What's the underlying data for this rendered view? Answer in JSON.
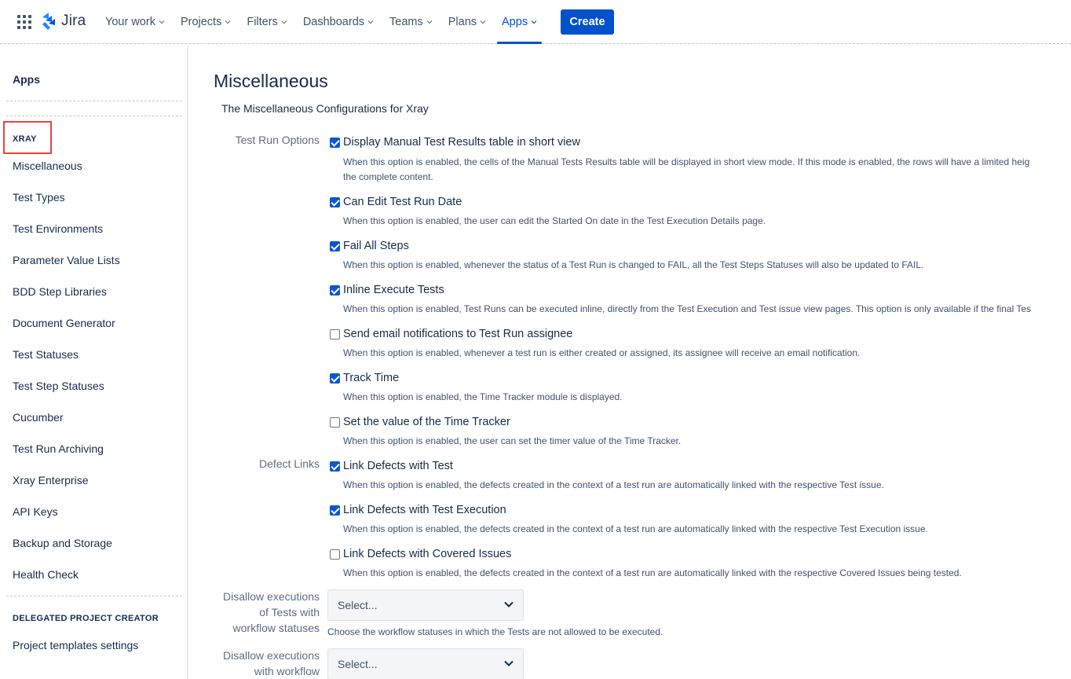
{
  "topnav": {
    "logo_text": "Jira",
    "items": [
      {
        "label": "Your work"
      },
      {
        "label": "Projects"
      },
      {
        "label": "Filters"
      },
      {
        "label": "Dashboards"
      },
      {
        "label": "Teams"
      },
      {
        "label": "Plans"
      },
      {
        "label": "Apps",
        "active": true
      }
    ],
    "create_label": "Create",
    "accent_color": "#0052cc"
  },
  "sidebar": {
    "title": "Apps",
    "section_xray": "XRAY",
    "items": [
      "Miscellaneous",
      "Test Types",
      "Test Environments",
      "Parameter Value Lists",
      "BDD Step Libraries",
      "Document Generator",
      "Test Statuses",
      "Test Step Statuses",
      "Cucumber",
      "Test Run Archiving",
      "Xray Enterprise",
      "API Keys",
      "Backup and Storage",
      "Health Check"
    ],
    "section_delegated": "DELEGATED PROJECT CREATOR",
    "delegated_items": [
      "Project templates settings"
    ],
    "highlight_color": "#e5483b"
  },
  "main": {
    "title": "Miscellaneous",
    "description": "The Miscellaneous Configurations for Xray",
    "test_run_options_label": "Test Run Options",
    "defect_links_label": "Defect Links",
    "options": [
      {
        "label": "Display Manual Test Results table in short view",
        "checked": true,
        "desc": "When this option is enabled, the cells of the Manual Tests Results table will be displayed in short view mode. If this mode is enabled, the rows will have a limited heig",
        "desc2": "the complete content."
      },
      {
        "label": "Can Edit Test Run Date",
        "checked": true,
        "desc": "When this option is enabled, the user can edit the Started On date in the Test Execution Details page."
      },
      {
        "label": "Fail All Steps",
        "checked": true,
        "desc": "When this option is enabled, whenever the status of a Test Run is changed to FAIL, all the Test Steps Statuses will also be updated to FAIL."
      },
      {
        "label": "Inline Execute Tests",
        "checked": true,
        "desc": "When this option is enabled, Test Runs can be executed inline, directly from the Test Execution and Test issue view pages. This option is only available if the final Tes"
      },
      {
        "label": "Send email notifications to Test Run assignee",
        "checked": false,
        "desc": "When this option is enabled, whenever a test run is either created or assigned, its assignee will receive an email notification."
      },
      {
        "label": "Track Time",
        "checked": true,
        "desc": "When this option is enabled, the Time Tracker module is displayed."
      },
      {
        "label": "Set the value of the Time Tracker",
        "checked": false,
        "desc": "When this option is enabled, the user can set the timer value of the Time Tracker."
      },
      {
        "label": "Link Defects with Test",
        "checked": true,
        "desc": "When this option is enabled, the defects created in the context of a test run are automatically linked with the respective Test issue."
      },
      {
        "label": "Link Defects with Test Execution",
        "checked": true,
        "desc": "When this option is enabled, the defects created in the context of a test run are automatically linked with the respective Test Execution issue."
      },
      {
        "label": "Link Defects with Covered Issues",
        "checked": false,
        "desc": "When this option is enabled, the defects created in the context of a test run are automatically linked with the respective Covered Issues being tested."
      }
    ],
    "disallow_tests": {
      "label_lines": [
        "Disallow executions",
        "of Tests with",
        "workflow statuses"
      ],
      "placeholder": "Select...",
      "help": "Choose the workflow statuses in which the Tests are not allowed to be executed."
    },
    "disallow_workflow": {
      "label_lines": [
        "Disallow executions",
        "with workflow"
      ],
      "placeholder": "Select..."
    }
  }
}
